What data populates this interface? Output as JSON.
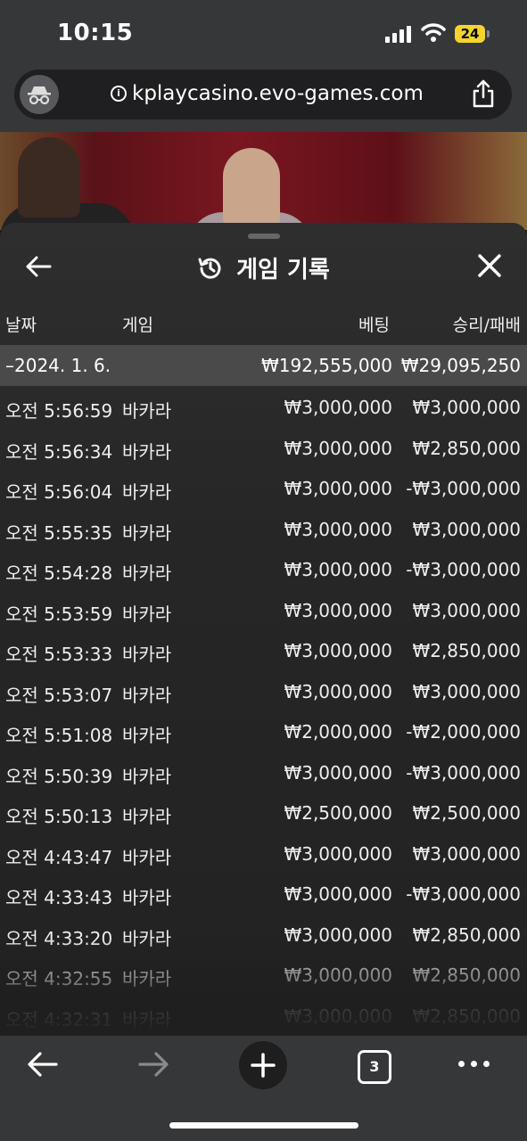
{
  "status_bar": {
    "time": "10:15",
    "battery": "24"
  },
  "browser": {
    "url": "kplaycasino.evo-games.com",
    "tab_count": "3"
  },
  "panel": {
    "title": "게임 기록",
    "columns": {
      "date": "날짜",
      "game": "게임",
      "bet": "베팅",
      "win_loss": "승리/패배"
    },
    "summary": {
      "date": "–2024. 1. 6.",
      "bet": "₩192,555,000",
      "win_loss": "₩29,095,250"
    },
    "rows": [
      {
        "time": "오전 5:56:59",
        "game": "바카라",
        "bet": "₩3,000,000",
        "win_loss": "₩3,000,000"
      },
      {
        "time": "오전 5:56:34",
        "game": "바카라",
        "bet": "₩3,000,000",
        "win_loss": "₩2,850,000"
      },
      {
        "time": "오전 5:56:04",
        "game": "바카라",
        "bet": "₩3,000,000",
        "win_loss": "-₩3,000,000"
      },
      {
        "time": "오전 5:55:35",
        "game": "바카라",
        "bet": "₩3,000,000",
        "win_loss": "₩3,000,000"
      },
      {
        "time": "오전 5:54:28",
        "game": "바카라",
        "bet": "₩3,000,000",
        "win_loss": "-₩3,000,000"
      },
      {
        "time": "오전 5:53:59",
        "game": "바카라",
        "bet": "₩3,000,000",
        "win_loss": "₩3,000,000"
      },
      {
        "time": "오전 5:53:33",
        "game": "바카라",
        "bet": "₩3,000,000",
        "win_loss": "₩2,850,000"
      },
      {
        "time": "오전 5:53:07",
        "game": "바카라",
        "bet": "₩3,000,000",
        "win_loss": "₩3,000,000"
      },
      {
        "time": "오전 5:51:08",
        "game": "바카라",
        "bet": "₩2,000,000",
        "win_loss": "-₩2,000,000"
      },
      {
        "time": "오전 5:50:39",
        "game": "바카라",
        "bet": "₩3,000,000",
        "win_loss": "-₩3,000,000"
      },
      {
        "time": "오전 5:50:13",
        "game": "바카라",
        "bet": "₩2,500,000",
        "win_loss": "₩2,500,000"
      },
      {
        "time": "오전 4:43:47",
        "game": "바카라",
        "bet": "₩3,000,000",
        "win_loss": "₩3,000,000"
      },
      {
        "time": "오전 4:33:43",
        "game": "바카라",
        "bet": "₩3,000,000",
        "win_loss": "-₩3,000,000"
      },
      {
        "time": "오전 4:33:20",
        "game": "바카라",
        "bet": "₩3,000,000",
        "win_loss": "₩2,850,000"
      },
      {
        "time": "오전 4:32:55",
        "game": "바카라",
        "bet": "₩3,000,000",
        "win_loss": "₩2,850,000"
      },
      {
        "time": "오전 4:32:31",
        "game": "바카라",
        "bet": "₩3,000,000",
        "win_loss": "₩2,850,000"
      }
    ]
  },
  "colors": {
    "battery": "#f5d42f",
    "panel_bg": "#2b2b2b",
    "summary_bg": "#4a4a4a"
  },
  "icons": [
    "incognito-icon",
    "info-icon",
    "share-icon",
    "back-arrow-icon",
    "history-icon",
    "close-icon",
    "forward-arrow-icon",
    "plus-icon",
    "tabs-icon",
    "more-icon"
  ]
}
